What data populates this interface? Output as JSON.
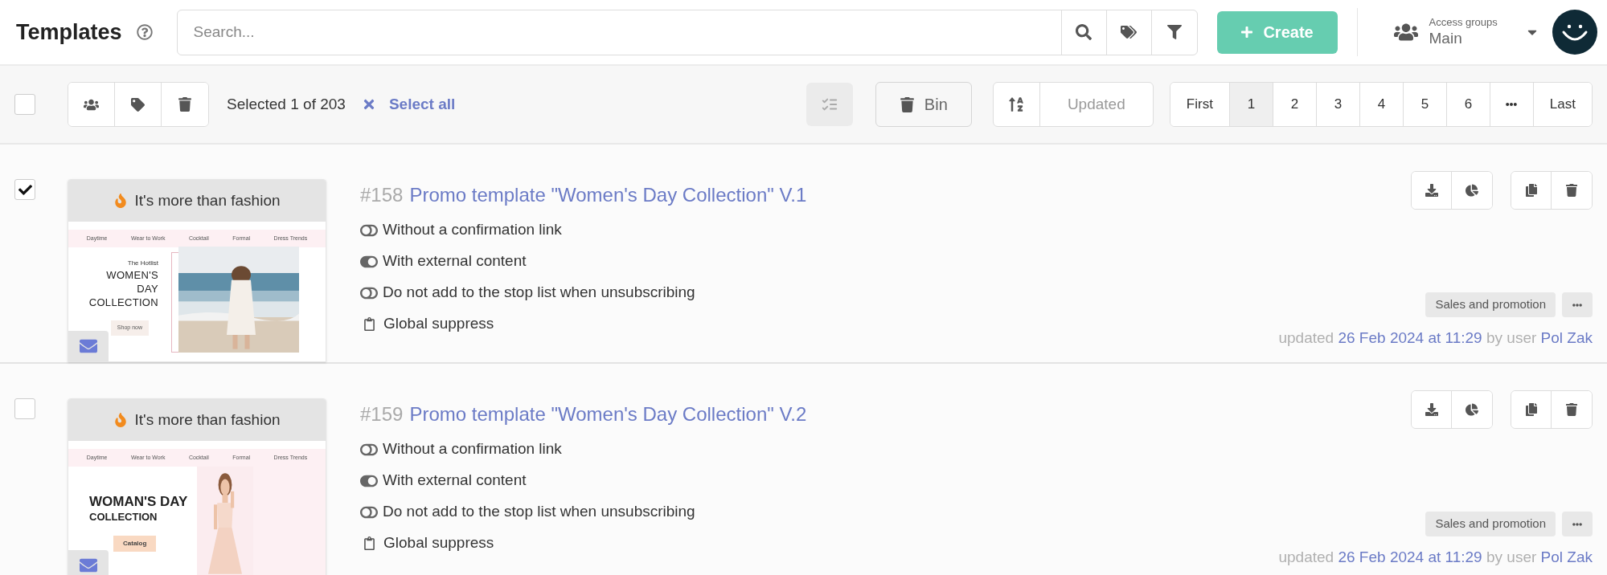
{
  "header": {
    "title": "Templates",
    "search": {
      "placeholder": "Search..."
    },
    "create_button": "Create",
    "access_groups": {
      "label": "Access groups",
      "value": "Main"
    }
  },
  "toolbar": {
    "select_all_checked": false,
    "selection_text": "Selected 1 of 203",
    "select_all_link": "Select all",
    "bin_button": "Bin",
    "sort_field": "Updated",
    "pagination": [
      {
        "kind": "text",
        "label": "First",
        "selected": false
      },
      {
        "kind": "text",
        "label": "1",
        "selected": true
      },
      {
        "kind": "text",
        "label": "2",
        "selected": false
      },
      {
        "kind": "text",
        "label": "3",
        "selected": false
      },
      {
        "kind": "text",
        "label": "4",
        "selected": false
      },
      {
        "kind": "text",
        "label": "5",
        "selected": false
      },
      {
        "kind": "text",
        "label": "6",
        "selected": false
      },
      {
        "kind": "ellipsis",
        "selected": false
      },
      {
        "kind": "text",
        "label": "Last",
        "selected": false
      }
    ]
  },
  "templates": [
    {
      "checked": true,
      "number": "#158",
      "title": "Promo template \"Women's Day Collection\" V.1",
      "preview": {
        "kind": "beach",
        "banner": "It's more than fashion",
        "nav": [
          "Daytime",
          "Wear to Work",
          "Cocktail",
          "Formal",
          "Dress Trends"
        ],
        "kicker": "The Hotlist",
        "headline": [
          "WOMEN'S",
          "DAY",
          "COLLECTION"
        ],
        "button": "Shop now"
      },
      "features": [
        {
          "kind": "toggle",
          "on": false,
          "label": "Without a confirmation link"
        },
        {
          "kind": "toggle",
          "on": true,
          "label": "With external content"
        },
        {
          "kind": "toggle",
          "on": false,
          "label": "Do not add to the stop list when unsubscribing"
        },
        {
          "kind": "clipboard",
          "label": "Global suppress"
        }
      ],
      "tag": "Sales and promotion",
      "updated": {
        "prefix": "updated",
        "date": "26 Feb 2024 at 11:29",
        "by": "by user",
        "user": "Pol Zak"
      }
    },
    {
      "checked": false,
      "number": "#159",
      "title": "Promo template \"Women's Day Collection\" V.2",
      "preview": {
        "kind": "studio",
        "banner": "It's more than fashion",
        "nav": [
          "Daytime",
          "Wear to Work",
          "Cocktail",
          "Formal",
          "Dress Trends"
        ],
        "headline": [
          "WOMAN'S DAY",
          "COLLECTION"
        ],
        "button": "Catalog"
      },
      "features": [
        {
          "kind": "toggle",
          "on": false,
          "label": "Without a confirmation link"
        },
        {
          "kind": "toggle",
          "on": true,
          "label": "With external content"
        },
        {
          "kind": "toggle",
          "on": false,
          "label": "Do not add to the stop list when unsubscribing"
        },
        {
          "kind": "clipboard",
          "label": "Global suppress"
        }
      ],
      "tag": "Sales and promotion",
      "updated": {
        "prefix": "updated",
        "date": "26 Feb 2024 at 11:29",
        "by": "by user",
        "user": "Pol Zak"
      }
    }
  ]
}
